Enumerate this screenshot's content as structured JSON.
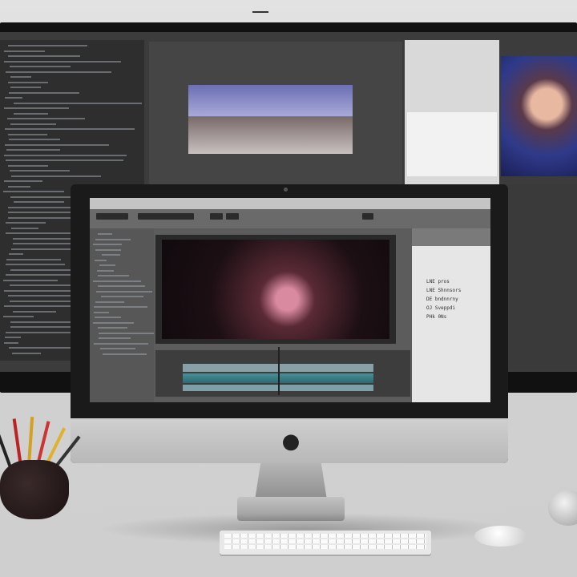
{
  "scene": {
    "subject": "desk-setup",
    "objects": [
      "back-monitor",
      "imac",
      "keyboard",
      "mouse",
      "pencil-cup",
      "second-mouse"
    ]
  },
  "imac": {
    "app": {
      "panel_lines": [
        "LNE pros",
        "LNE Shnnsors",
        "DE bndnnrny",
        "OJ Sveppdi",
        "PHk 0Ns"
      ]
    }
  },
  "colors": {
    "desk": "#d6d6d6",
    "bezel": "#111111",
    "timeline_track": "#4a8f96",
    "viewer_highlight": "#d98aa0"
  }
}
